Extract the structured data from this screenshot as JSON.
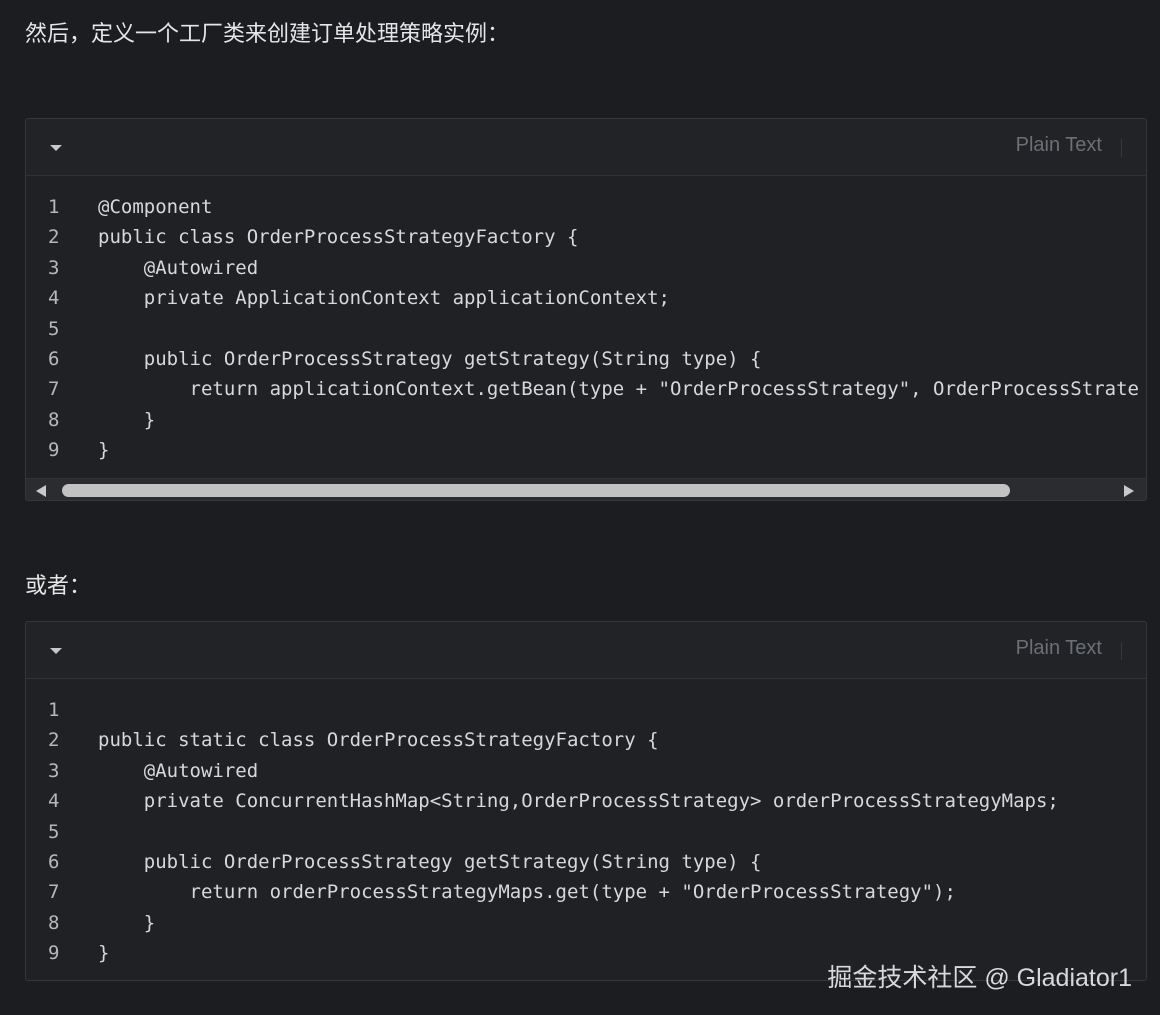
{
  "intro_text": "然后，定义一个工厂类来创建订单处理策略实例：",
  "or_text": "或者：",
  "watermark": "掘金技术社区 @ Gladiator1",
  "code_blocks": [
    {
      "language": "Plain Text",
      "lines": [
        {
          "num": "1",
          "text": "@Component"
        },
        {
          "num": "2",
          "text": "public class OrderProcessStrategyFactory {"
        },
        {
          "num": "3",
          "text": "    @Autowired"
        },
        {
          "num": "4",
          "text": "    private ApplicationContext applicationContext;"
        },
        {
          "num": "5",
          "text": ""
        },
        {
          "num": "6",
          "text": "    public OrderProcessStrategy getStrategy(String type) {"
        },
        {
          "num": "7",
          "text": "        return applicationContext.getBean(type + \"OrderProcessStrategy\", OrderProcessStrate"
        },
        {
          "num": "8",
          "text": "    }"
        },
        {
          "num": "9",
          "text": "}"
        }
      ]
    },
    {
      "language": "Plain Text",
      "lines": [
        {
          "num": "1",
          "text": ""
        },
        {
          "num": "2",
          "text": "public static class OrderProcessStrategyFactory {"
        },
        {
          "num": "3",
          "text": "    @Autowired"
        },
        {
          "num": "4",
          "text": "    private ConcurrentHashMap<String,OrderProcessStrategy> orderProcessStrategyMaps;"
        },
        {
          "num": "5",
          "text": ""
        },
        {
          "num": "6",
          "text": "    public OrderProcessStrategy getStrategy(String type) {"
        },
        {
          "num": "7",
          "text": "        return orderProcessStrategyMaps.get(type + \"OrderProcessStrategy\");"
        },
        {
          "num": "8",
          "text": "    }"
        },
        {
          "num": "9",
          "text": "}"
        }
      ]
    }
  ]
}
